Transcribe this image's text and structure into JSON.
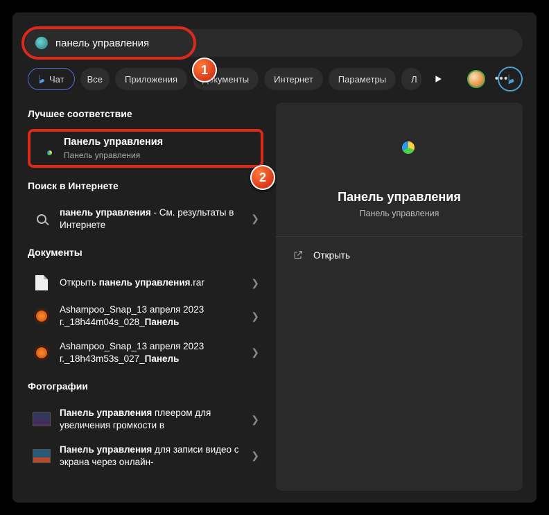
{
  "search": {
    "value": "панель управления"
  },
  "tabs": {
    "chat": "Чат",
    "all": "Все",
    "apps": "Приложения",
    "docs": "Документы",
    "internet": "Интернет",
    "params": "Параметры",
    "cut": "Л"
  },
  "sections": {
    "best": "Лучшее соответствие",
    "web": "Поиск в Интернете",
    "docs": "Документы",
    "photos": "Фотографии"
  },
  "best": {
    "title": "Панель управления",
    "sub": "Панель управления"
  },
  "web1": {
    "bold": "панель управления",
    "rest": " - См. результаты в Интернете"
  },
  "doc1": {
    "pre": "Открыть ",
    "bold": "панель управления",
    "post": ".rar"
  },
  "doc2": {
    "line1": "Ashampoo_Snap_13 апреля 2023 г._18h44m04s_028_",
    "bold": "Панель"
  },
  "doc3": {
    "line1": "Ashampoo_Snap_13 апреля 2023 г._18h43m53s_027_",
    "bold": "Панель"
  },
  "ph1": {
    "bold": "Панель управления",
    "rest": " плеером для увеличения громкости в"
  },
  "ph2": {
    "bold": "Панель управления",
    "rest": " для записи видео с экрана через онлайн-"
  },
  "preview": {
    "title": "Панель управления",
    "sub": "Панель управления",
    "open": "Открыть"
  },
  "badges": {
    "one": "1",
    "two": "2"
  }
}
